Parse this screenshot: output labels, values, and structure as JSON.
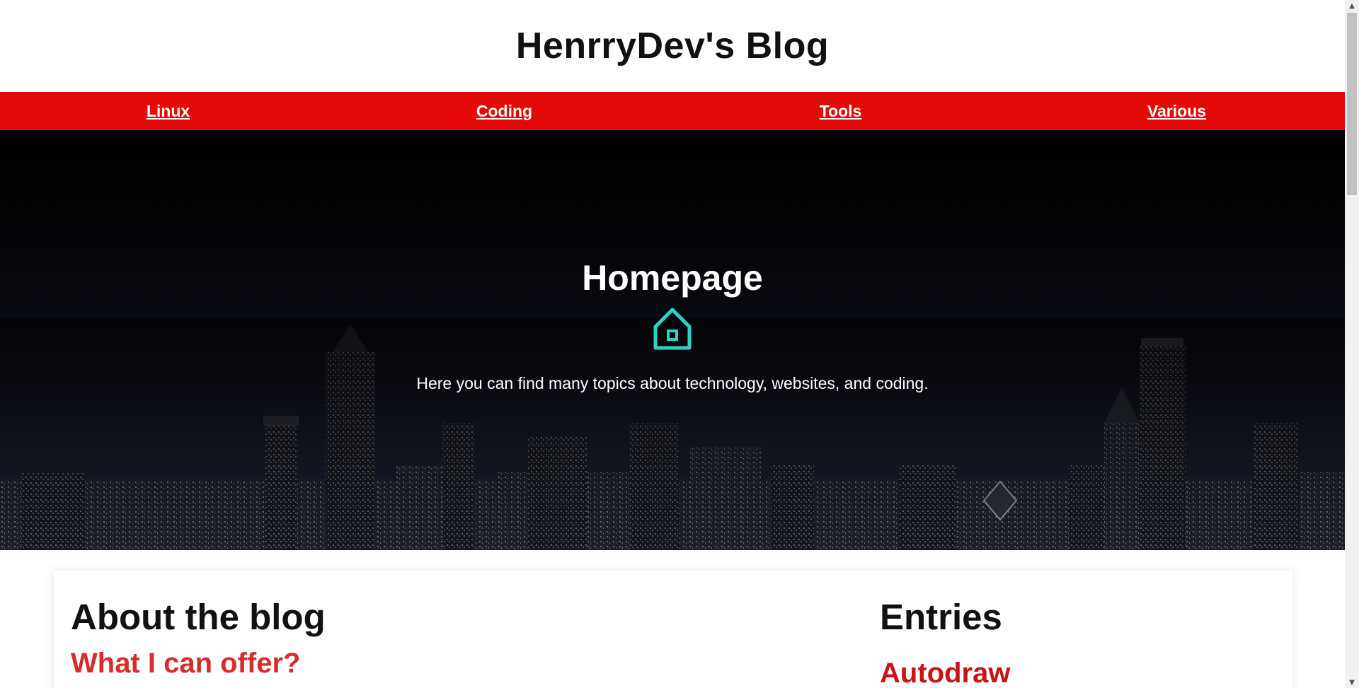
{
  "header": {
    "title": "HenrryDev's Blog"
  },
  "nav": {
    "items": [
      {
        "label": "Linux"
      },
      {
        "label": "Coding"
      },
      {
        "label": "Tools"
      },
      {
        "label": "Various"
      }
    ],
    "color": "#e50a0a"
  },
  "hero": {
    "title": "Homepage",
    "icon": "home-icon",
    "icon_color": "#2dd4c4",
    "description": "Here you can find many topics about technology, websites, and coding."
  },
  "about": {
    "title": "About the blog",
    "subtitle": "What I can offer?"
  },
  "entries": {
    "title": "Entries",
    "items": [
      {
        "label": "Autodraw"
      }
    ]
  },
  "scrollbar": {
    "up_icon": "chevron-up-icon",
    "down_icon": "chevron-down-icon"
  }
}
